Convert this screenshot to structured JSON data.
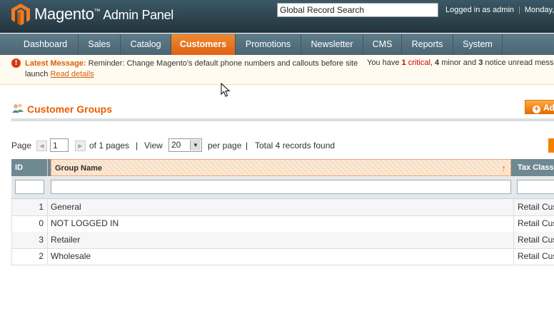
{
  "header": {
    "logo_name": "Magento",
    "logo_tm": "™",
    "logo_suffix": "Admin Panel",
    "search_value": "Global Record Search",
    "logged_in": "Logged in as admin",
    "date": "Monday,"
  },
  "nav": {
    "items": [
      {
        "label": "Dashboard"
      },
      {
        "label": "Sales"
      },
      {
        "label": "Catalog"
      },
      {
        "label": "Customers",
        "active": true
      },
      {
        "label": "Promotions"
      },
      {
        "label": "Newsletter"
      },
      {
        "label": "CMS"
      },
      {
        "label": "Reports"
      },
      {
        "label": "System"
      }
    ]
  },
  "message": {
    "icon": "!",
    "label": "Latest Message:",
    "text": "Reminder: Change Magento's default phone numbers and callouts before site launch",
    "read_details": "Read details",
    "right_prefix": "You have",
    "critical_count": "1",
    "critical_label": "critical",
    "minor_count": "4",
    "minor_label": "minor and",
    "notice_count": "3",
    "notice_label": "notice unread messa"
  },
  "page": {
    "title": "Customer Groups",
    "add_button": "Ad"
  },
  "pager": {
    "page_label": "Page",
    "page_value": "1",
    "of_pages": "of 1 pages",
    "view_label": "View",
    "per_page_value": "20",
    "per_page_label": "per page",
    "total": "Total 4 records found",
    "sep": "|"
  },
  "grid": {
    "columns": [
      {
        "label": "ID"
      },
      {
        "label": "Group Name",
        "sorted": "asc"
      },
      {
        "label": "Tax Class"
      }
    ],
    "sort_arrow": "↑",
    "rows": [
      {
        "id": "1",
        "name": "General",
        "tax": "Retail Customer"
      },
      {
        "id": "0",
        "name": "NOT LOGGED IN",
        "tax": "Retail Customer"
      },
      {
        "id": "3",
        "name": "Retailer",
        "tax": "Retail Customer"
      },
      {
        "id": "2",
        "name": "Wholesale",
        "tax": "Retail Customer"
      }
    ]
  },
  "colors": {
    "accent": "#eb5e00",
    "nav_active": "#e66b15",
    "header_bg": "#2a4451"
  }
}
